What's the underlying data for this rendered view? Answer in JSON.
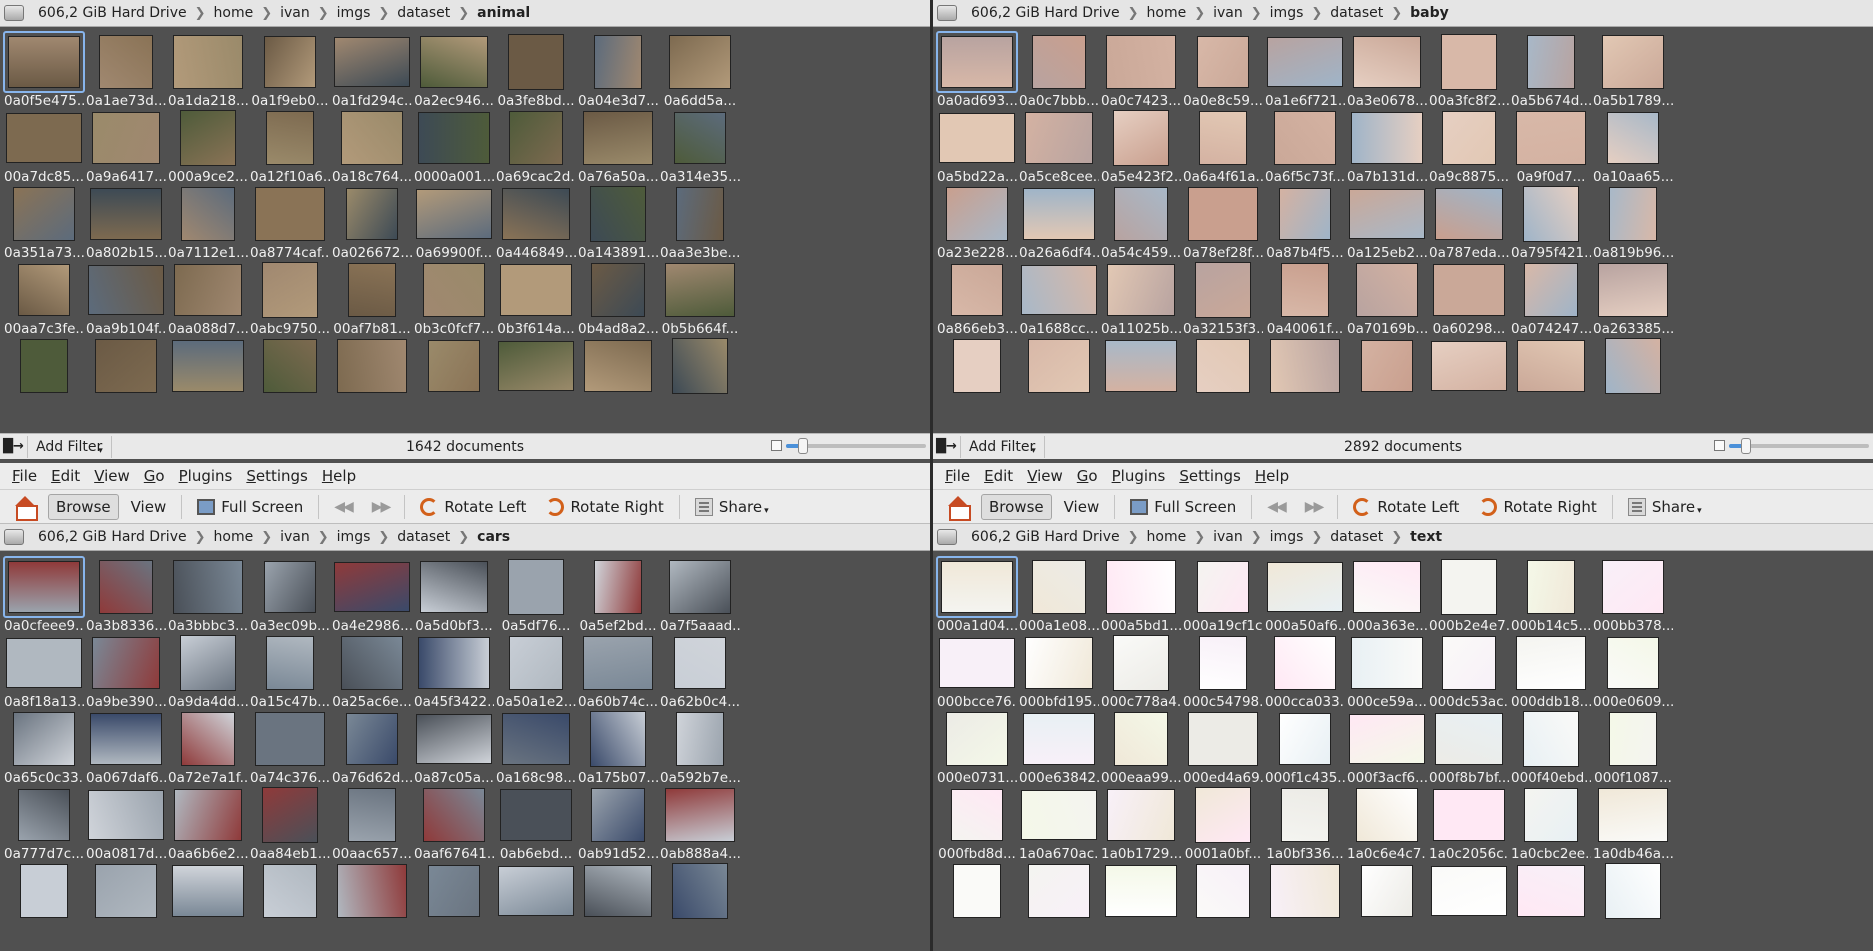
{
  "menu": [
    "File",
    "Edit",
    "View",
    "Go",
    "Plugins",
    "Settings",
    "Help"
  ],
  "toolbar": {
    "browse": "Browse",
    "view": "View",
    "full_screen": "Full Screen",
    "rotate_left": "Rotate Left",
    "rotate_right": "Rotate Right",
    "share": "Share"
  },
  "statusbar": {
    "add_filter": "Add Filter"
  },
  "panes": [
    {
      "id": "animal",
      "crumbs": [
        "606,2 GiB Hard Drive",
        "home",
        "ivan",
        "imgs",
        "dataset",
        "animal"
      ],
      "doc_count": "1642 documents",
      "zoom": 0.12,
      "rows": [
        [
          "0a0f5e475...",
          "0a1ae73d...",
          "0a1da218...",
          "0a1f9eb0...",
          "0a1fd294c...",
          "0a2ec946...",
          "0a3fe8bd...",
          "0a04e3d7...",
          "0a6dd5a..."
        ],
        [
          "00a7dc85...",
          "0a9a6417...",
          "000a9ce2...",
          "0a12f10a6...",
          "0a18c764...",
          "0000a001...",
          "0a69cac2d...",
          "0a76a50a...",
          "0a314e35..."
        ],
        [
          "0a351a73...",
          "0a802b15...",
          "0a7112e1...",
          "0a8774caf...",
          "0a026672...",
          "0a69900f...",
          "0a446849...",
          "0a143891...",
          "0aa3e3be..."
        ],
        [
          "00aa7c3fe...",
          "0aa9b104f...",
          "0aa088d7...",
          "0abc9750...",
          "00af7b81...",
          "0b3c0fcf7...",
          "0b3f614a...",
          "0b4ad8a2...",
          "0b5b664f..."
        ],
        [
          "",
          "",
          "",
          "",
          "",
          "",
          "",
          "",
          ""
        ]
      ]
    },
    {
      "id": "baby",
      "crumbs": [
        "606,2 GiB Hard Drive",
        "home",
        "ivan",
        "imgs",
        "dataset",
        "baby"
      ],
      "doc_count": "2892 documents",
      "zoom": 0.12,
      "rows": [
        [
          "0a0ad693...",
          "0a0c7bbb...",
          "0a0c7423...",
          "0a0e8c59...",
          "0a1e6f721...",
          "0a3e0678...",
          "00a3fc8f2...",
          "0a5b674d...",
          "0a5b1789..."
        ],
        [
          "0a5bd22a...",
          "0a5ce8cee...",
          "0a5e423f2...",
          "0a6a4f61a...",
          "0a6f5c73f...",
          "0a7b131d...",
          "0a9c8875...",
          "0a9f0d7...",
          "0a10aa65..."
        ],
        [
          "0a23e228...",
          "0a26a6df4...",
          "0a54c459...",
          "0a78ef28f...",
          "0a87b4f5...",
          "0a125eb2...",
          "0a787eda...",
          "0a795f421...",
          "0a819b96..."
        ],
        [
          "0a866eb3...",
          "0a1688cc...",
          "0a11025b...",
          "0a32153f3...",
          "0a40061f...",
          "0a70169b...",
          "0a60298...",
          "0a074247...",
          "0a263385..."
        ],
        [
          "",
          "",
          "",
          "",
          "",
          "",
          "",
          "",
          ""
        ]
      ]
    },
    {
      "id": "cars",
      "crumbs": [
        "606,2 GiB Hard Drive",
        "home",
        "ivan",
        "imgs",
        "dataset",
        "cars"
      ],
      "rows": [
        [
          "0a0cfeee9...",
          "0a3b8336...",
          "0a3bbbc3...",
          "0a3ec09b...",
          "0a4e2986...",
          "0a5d0bf3...",
          "0a5df76...",
          "0a5ef2bd...",
          "0a7f5aaad..."
        ],
        [
          "0a8f18a13...",
          "0a9be390...",
          "0a9da4dd...",
          "0a15c47b...",
          "0a25ac6e...",
          "0a45f3422...",
          "0a50a1e2...",
          "0a60b74c...",
          "0a62b0c4..."
        ],
        [
          "0a65c0c33...",
          "0a067daf6...",
          "0a72e7a1f...",
          "0a74c376...",
          "0a76d62d...",
          "0a87c05a...",
          "0a168c98...",
          "0a175b07...",
          "0a592b7e..."
        ],
        [
          "0a777d7c...",
          "00a0817d...",
          "0aa6b6e2...",
          "0aa84eb1...",
          "00aac657...",
          "0aaf67641...",
          "0ab6ebd...",
          "0ab91d52...",
          "0ab888a4..."
        ],
        [
          "",
          "",
          "",
          "",
          "",
          "",
          "",
          "",
          ""
        ]
      ]
    },
    {
      "id": "text",
      "crumbs": [
        "606,2 GiB Hard Drive",
        "home",
        "ivan",
        "imgs",
        "dataset",
        "text"
      ],
      "rows": [
        [
          "000a1d04...",
          "000a1e08...",
          "000a5bd1...",
          "000a19cf1c...",
          "000a50af6...",
          "000a363e...",
          "000b2e4e7...",
          "000b14c5...",
          "000bb378..."
        ],
        [
          "000bcce76...",
          "000bfd195...",
          "000c778a4...",
          "000c54798...",
          "000cca033...",
          "000ce59a...",
          "000dc53ac...",
          "000ddb18...",
          "000e0609..."
        ],
        [
          "000e0731...",
          "000e63842...",
          "000eaa99...",
          "000ed4a69...",
          "000f1c435...",
          "000f3acf6...",
          "000f8b7bf...",
          "000f40ebd...",
          "000f1087..."
        ],
        [
          "000fbd8d...",
          "1a0a670ac...",
          "1a0b1729...",
          "0001a0bf...",
          "1a0bf336...",
          "1a0c6e4c7...",
          "1a0c2056c...",
          "1a0cbc2ee...",
          "1a0db46a..."
        ],
        [
          "",
          "",
          "",
          "",
          "",
          "",
          "",
          "",
          ""
        ]
      ]
    }
  ]
}
